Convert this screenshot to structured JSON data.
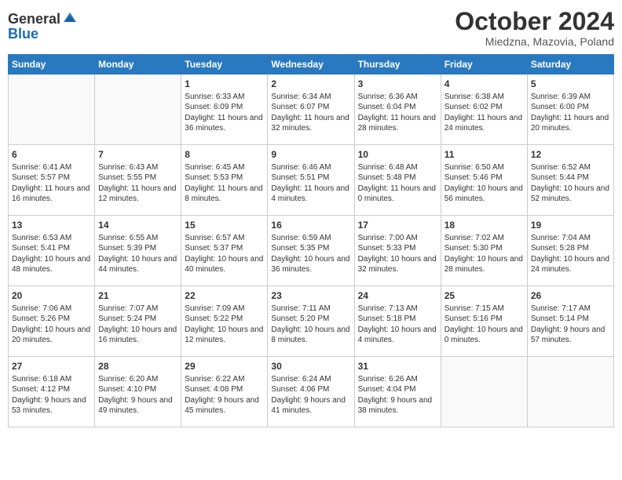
{
  "header": {
    "logo_general": "General",
    "logo_blue": "Blue",
    "month_title": "October 2024",
    "location": "Miedzna, Mazovia, Poland"
  },
  "days_of_week": [
    "Sunday",
    "Monday",
    "Tuesday",
    "Wednesday",
    "Thursday",
    "Friday",
    "Saturday"
  ],
  "weeks": [
    [
      {
        "day": "",
        "info": ""
      },
      {
        "day": "",
        "info": ""
      },
      {
        "day": "1",
        "info": "Sunrise: 6:33 AM\nSunset: 6:09 PM\nDaylight: 11 hours and 36 minutes."
      },
      {
        "day": "2",
        "info": "Sunrise: 6:34 AM\nSunset: 6:07 PM\nDaylight: 11 hours and 32 minutes."
      },
      {
        "day": "3",
        "info": "Sunrise: 6:36 AM\nSunset: 6:04 PM\nDaylight: 11 hours and 28 minutes."
      },
      {
        "day": "4",
        "info": "Sunrise: 6:38 AM\nSunset: 6:02 PM\nDaylight: 11 hours and 24 minutes."
      },
      {
        "day": "5",
        "info": "Sunrise: 6:39 AM\nSunset: 6:00 PM\nDaylight: 11 hours and 20 minutes."
      }
    ],
    [
      {
        "day": "6",
        "info": "Sunrise: 6:41 AM\nSunset: 5:57 PM\nDaylight: 11 hours and 16 minutes."
      },
      {
        "day": "7",
        "info": "Sunrise: 6:43 AM\nSunset: 5:55 PM\nDaylight: 11 hours and 12 minutes."
      },
      {
        "day": "8",
        "info": "Sunrise: 6:45 AM\nSunset: 5:53 PM\nDaylight: 11 hours and 8 minutes."
      },
      {
        "day": "9",
        "info": "Sunrise: 6:46 AM\nSunset: 5:51 PM\nDaylight: 11 hours and 4 minutes."
      },
      {
        "day": "10",
        "info": "Sunrise: 6:48 AM\nSunset: 5:48 PM\nDaylight: 11 hours and 0 minutes."
      },
      {
        "day": "11",
        "info": "Sunrise: 6:50 AM\nSunset: 5:46 PM\nDaylight: 10 hours and 56 minutes."
      },
      {
        "day": "12",
        "info": "Sunrise: 6:52 AM\nSunset: 5:44 PM\nDaylight: 10 hours and 52 minutes."
      }
    ],
    [
      {
        "day": "13",
        "info": "Sunrise: 6:53 AM\nSunset: 5:41 PM\nDaylight: 10 hours and 48 minutes."
      },
      {
        "day": "14",
        "info": "Sunrise: 6:55 AM\nSunset: 5:39 PM\nDaylight: 10 hours and 44 minutes."
      },
      {
        "day": "15",
        "info": "Sunrise: 6:57 AM\nSunset: 5:37 PM\nDaylight: 10 hours and 40 minutes."
      },
      {
        "day": "16",
        "info": "Sunrise: 6:59 AM\nSunset: 5:35 PM\nDaylight: 10 hours and 36 minutes."
      },
      {
        "day": "17",
        "info": "Sunrise: 7:00 AM\nSunset: 5:33 PM\nDaylight: 10 hours and 32 minutes."
      },
      {
        "day": "18",
        "info": "Sunrise: 7:02 AM\nSunset: 5:30 PM\nDaylight: 10 hours and 28 minutes."
      },
      {
        "day": "19",
        "info": "Sunrise: 7:04 AM\nSunset: 5:28 PM\nDaylight: 10 hours and 24 minutes."
      }
    ],
    [
      {
        "day": "20",
        "info": "Sunrise: 7:06 AM\nSunset: 5:26 PM\nDaylight: 10 hours and 20 minutes."
      },
      {
        "day": "21",
        "info": "Sunrise: 7:07 AM\nSunset: 5:24 PM\nDaylight: 10 hours and 16 minutes."
      },
      {
        "day": "22",
        "info": "Sunrise: 7:09 AM\nSunset: 5:22 PM\nDaylight: 10 hours and 12 minutes."
      },
      {
        "day": "23",
        "info": "Sunrise: 7:11 AM\nSunset: 5:20 PM\nDaylight: 10 hours and 8 minutes."
      },
      {
        "day": "24",
        "info": "Sunrise: 7:13 AM\nSunset: 5:18 PM\nDaylight: 10 hours and 4 minutes."
      },
      {
        "day": "25",
        "info": "Sunrise: 7:15 AM\nSunset: 5:16 PM\nDaylight: 10 hours and 0 minutes."
      },
      {
        "day": "26",
        "info": "Sunrise: 7:17 AM\nSunset: 5:14 PM\nDaylight: 9 hours and 57 minutes."
      }
    ],
    [
      {
        "day": "27",
        "info": "Sunrise: 6:18 AM\nSunset: 4:12 PM\nDaylight: 9 hours and 53 minutes."
      },
      {
        "day": "28",
        "info": "Sunrise: 6:20 AM\nSunset: 4:10 PM\nDaylight: 9 hours and 49 minutes."
      },
      {
        "day": "29",
        "info": "Sunrise: 6:22 AM\nSunset: 4:08 PM\nDaylight: 9 hours and 45 minutes."
      },
      {
        "day": "30",
        "info": "Sunrise: 6:24 AM\nSunset: 4:06 PM\nDaylight: 9 hours and 41 minutes."
      },
      {
        "day": "31",
        "info": "Sunrise: 6:26 AM\nSunset: 4:04 PM\nDaylight: 9 hours and 38 minutes."
      },
      {
        "day": "",
        "info": ""
      },
      {
        "day": "",
        "info": ""
      }
    ]
  ]
}
